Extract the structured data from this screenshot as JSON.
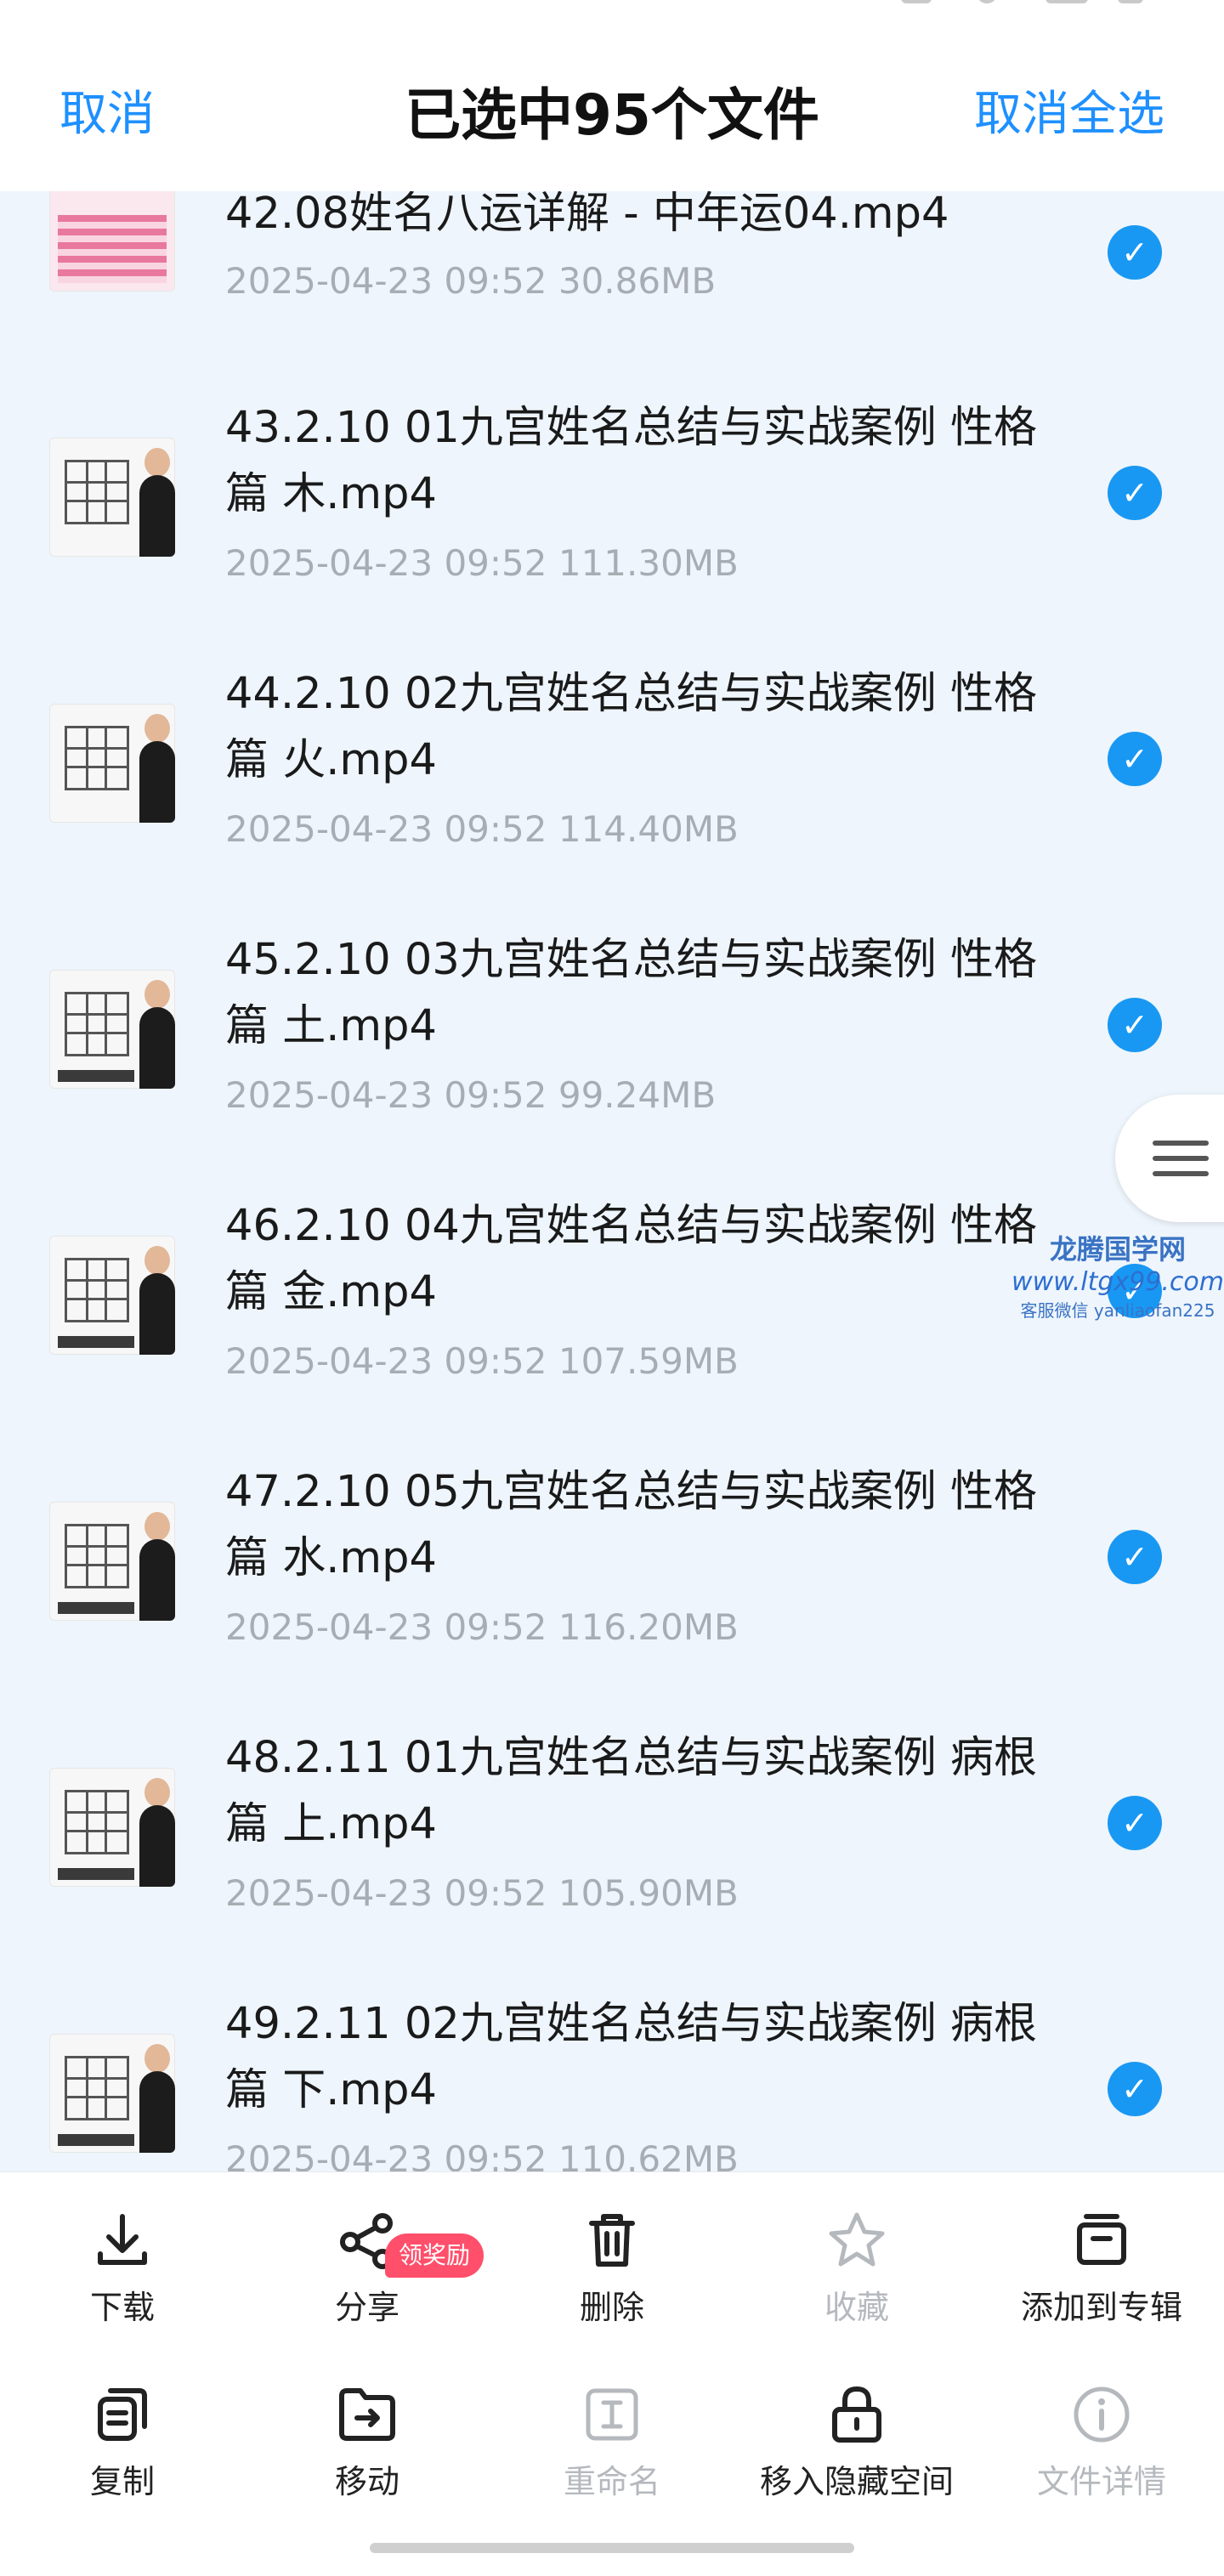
{
  "header": {
    "cancel_label": "取消",
    "title": "已选中95个文件",
    "deselect_all_label": "取消全选"
  },
  "files": [
    {
      "name": "42.08姓名八运详解 - 中年运04.mp4",
      "date": "2025-04-23",
      "time": "09:52",
      "size": "30.86MB",
      "selected": true
    },
    {
      "name": "43.2.10 01九宫姓名总结与实战案例 性格篇 木.mp4",
      "date": "2025-04-23",
      "time": "09:52",
      "size": "111.30MB",
      "selected": true
    },
    {
      "name": "44.2.10 02九宫姓名总结与实战案例 性格篇 火.mp4",
      "date": "2025-04-23",
      "time": "09:52",
      "size": "114.40MB",
      "selected": true
    },
    {
      "name": "45.2.10 03九宫姓名总结与实战案例 性格篇 土.mp4",
      "date": "2025-04-23",
      "time": "09:52",
      "size": "99.24MB",
      "selected": true
    },
    {
      "name": "46.2.10 04九宫姓名总结与实战案例 性格篇 金.mp4",
      "date": "2025-04-23",
      "time": "09:52",
      "size": "107.59MB",
      "selected": true
    },
    {
      "name": "47.2.10 05九宫姓名总结与实战案例 性格篇 水.mp4",
      "date": "2025-04-23",
      "time": "09:52",
      "size": "116.20MB",
      "selected": true
    },
    {
      "name": "48.2.11 01九宫姓名总结与实战案例 病根篇 上.mp4",
      "date": "2025-04-23",
      "time": "09:52",
      "size": "105.90MB",
      "selected": true
    },
    {
      "name": "49.2.11 02九宫姓名总结与实战案例 病根篇 下.mp4",
      "date": "2025-04-23",
      "time": "09:52",
      "size": "110.62MB",
      "selected": true
    }
  ],
  "watermark": {
    "line1": "龙腾国学网",
    "line2": "www.ltgx99.com",
    "line3": "客服微信 yanliaofan225"
  },
  "toolbar": {
    "download": "下载",
    "share": "分享",
    "share_badge": "领奖励",
    "delete": "删除",
    "favorite": "收藏",
    "add_to_album": "添加到专辑",
    "copy": "复制",
    "move": "移动",
    "rename": "重命名",
    "move_to_hidden": "移入隐藏空间",
    "file_details": "文件详情"
  },
  "colors": {
    "accent": "#1e90ff",
    "check": "#1898f3",
    "list_background": "#eef5fc",
    "badge": "#ff4f6b",
    "disabled_text": "#b5b9be"
  }
}
